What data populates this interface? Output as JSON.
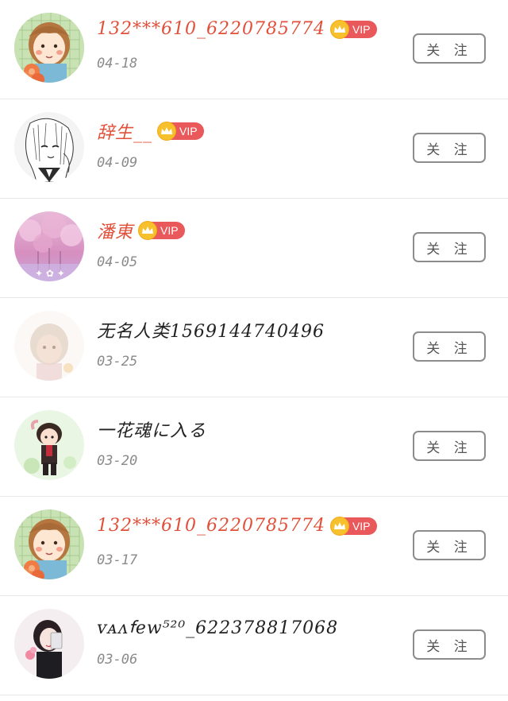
{
  "follow_label": "关 注",
  "vip_label": "VIP",
  "colors": {
    "vip_name": "#e0503a",
    "normal_name": "#222222",
    "date": "#8a8a8a",
    "vip_badge": "#e9585a",
    "crown": "#f6c12c",
    "button_border": "#8c8c8c"
  },
  "users": [
    {
      "name": "132***610_6220785774",
      "vip": true,
      "date": "04-18",
      "avatar": "cartoon-girl-flowers"
    },
    {
      "name": "辞生__",
      "vip": true,
      "date": "04-09",
      "avatar": "sketch-anime-girl"
    },
    {
      "name": "潘東",
      "vip": true,
      "date": "04-05",
      "avatar": "pink-blossom-tree"
    },
    {
      "name": "无名人类1569144740496",
      "vip": false,
      "date": "03-25",
      "avatar": "faded-girl"
    },
    {
      "name": "一花魂に入る",
      "vip": false,
      "date": "03-20",
      "avatar": "chibi-boy"
    },
    {
      "name": "132***610_6220785774",
      "vip": true,
      "date": "03-17",
      "avatar": "cartoon-girl-flowers"
    },
    {
      "name": "ᴠᴀᴧꬵew⁵²⁰_6223788170​68",
      "vip": false,
      "date": "03-06",
      "avatar": "girl-selfie"
    }
  ]
}
